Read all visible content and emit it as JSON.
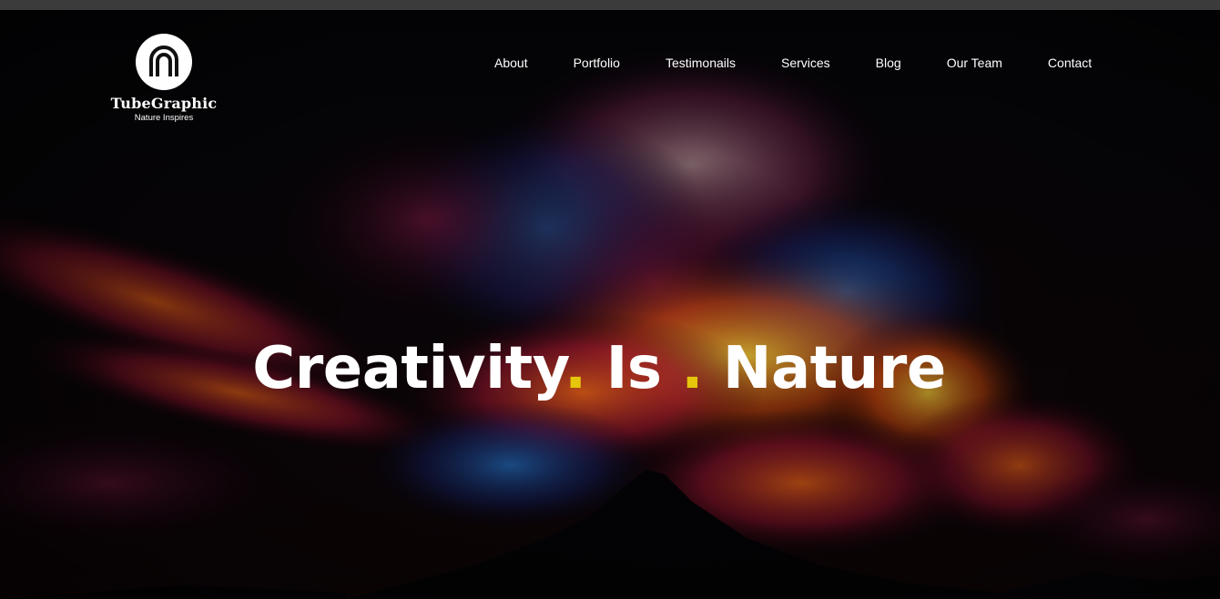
{
  "brand": {
    "name": "TubeGraphic",
    "tagline": "Nature Inspires",
    "logo_icon": "arch-tube-icon"
  },
  "nav": {
    "items": [
      {
        "label": "About"
      },
      {
        "label": "Portfolio"
      },
      {
        "label": "Testimonails"
      },
      {
        "label": "Services"
      },
      {
        "label": "Blog"
      },
      {
        "label": "Our Team"
      },
      {
        "label": "Contact"
      }
    ]
  },
  "hero": {
    "headline_parts": [
      "Creativity",
      ".",
      " Is ",
      ".",
      " Nature"
    ],
    "accent_color": "#e6c60a",
    "text_color": "#ffffff",
    "background": "volcano-colorful-smoke-clouds"
  }
}
